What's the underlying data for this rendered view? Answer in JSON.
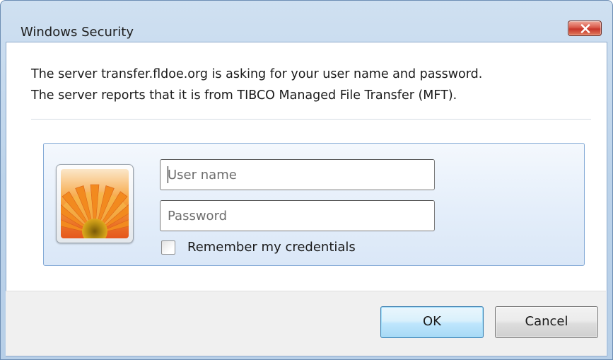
{
  "window": {
    "title": "Windows Security"
  },
  "message": {
    "line1": "The server transfer.fldoe.org is asking for your user name and password.",
    "line2": "The server reports that it is from TIBCO Managed File Transfer (MFT)."
  },
  "credentials": {
    "username": {
      "value": "",
      "placeholder": "User name"
    },
    "password": {
      "value": "",
      "placeholder": "Password"
    },
    "remember": {
      "label": "Remember my credentials",
      "checked": false
    }
  },
  "buttons": {
    "ok_label": "OK",
    "cancel_label": "Cancel"
  },
  "icons": {
    "close": "close-icon",
    "user_tile": "user-tile-icon"
  },
  "colors": {
    "close_button": "#c7352a",
    "ok_button_border": "#3c7fb1",
    "panel_border": "#84aad6"
  }
}
